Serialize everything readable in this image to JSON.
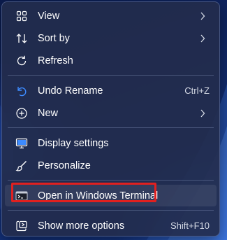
{
  "menu": {
    "items": [
      {
        "label": "View",
        "icon": "grid-icon",
        "submenu": true
      },
      {
        "label": "Sort by",
        "icon": "sort-icon",
        "submenu": true
      },
      {
        "label": "Refresh",
        "icon": "refresh-icon"
      },
      {
        "label": "Undo Rename",
        "icon": "undo-icon",
        "shortcut": "Ctrl+Z"
      },
      {
        "label": "New",
        "icon": "new-icon",
        "submenu": true
      },
      {
        "label": "Display settings",
        "icon": "display-icon"
      },
      {
        "label": "Personalize",
        "icon": "brush-icon"
      },
      {
        "label": "Open in Windows Terminal",
        "icon": "terminal-icon",
        "highlighted": true
      },
      {
        "label": "Show more options",
        "icon": "show-more-icon",
        "shortcut": "Shift+F10"
      }
    ]
  },
  "colors": {
    "menu_background": "#222c4c",
    "highlight_outline": "#e1201f",
    "text": "#ffffff"
  }
}
